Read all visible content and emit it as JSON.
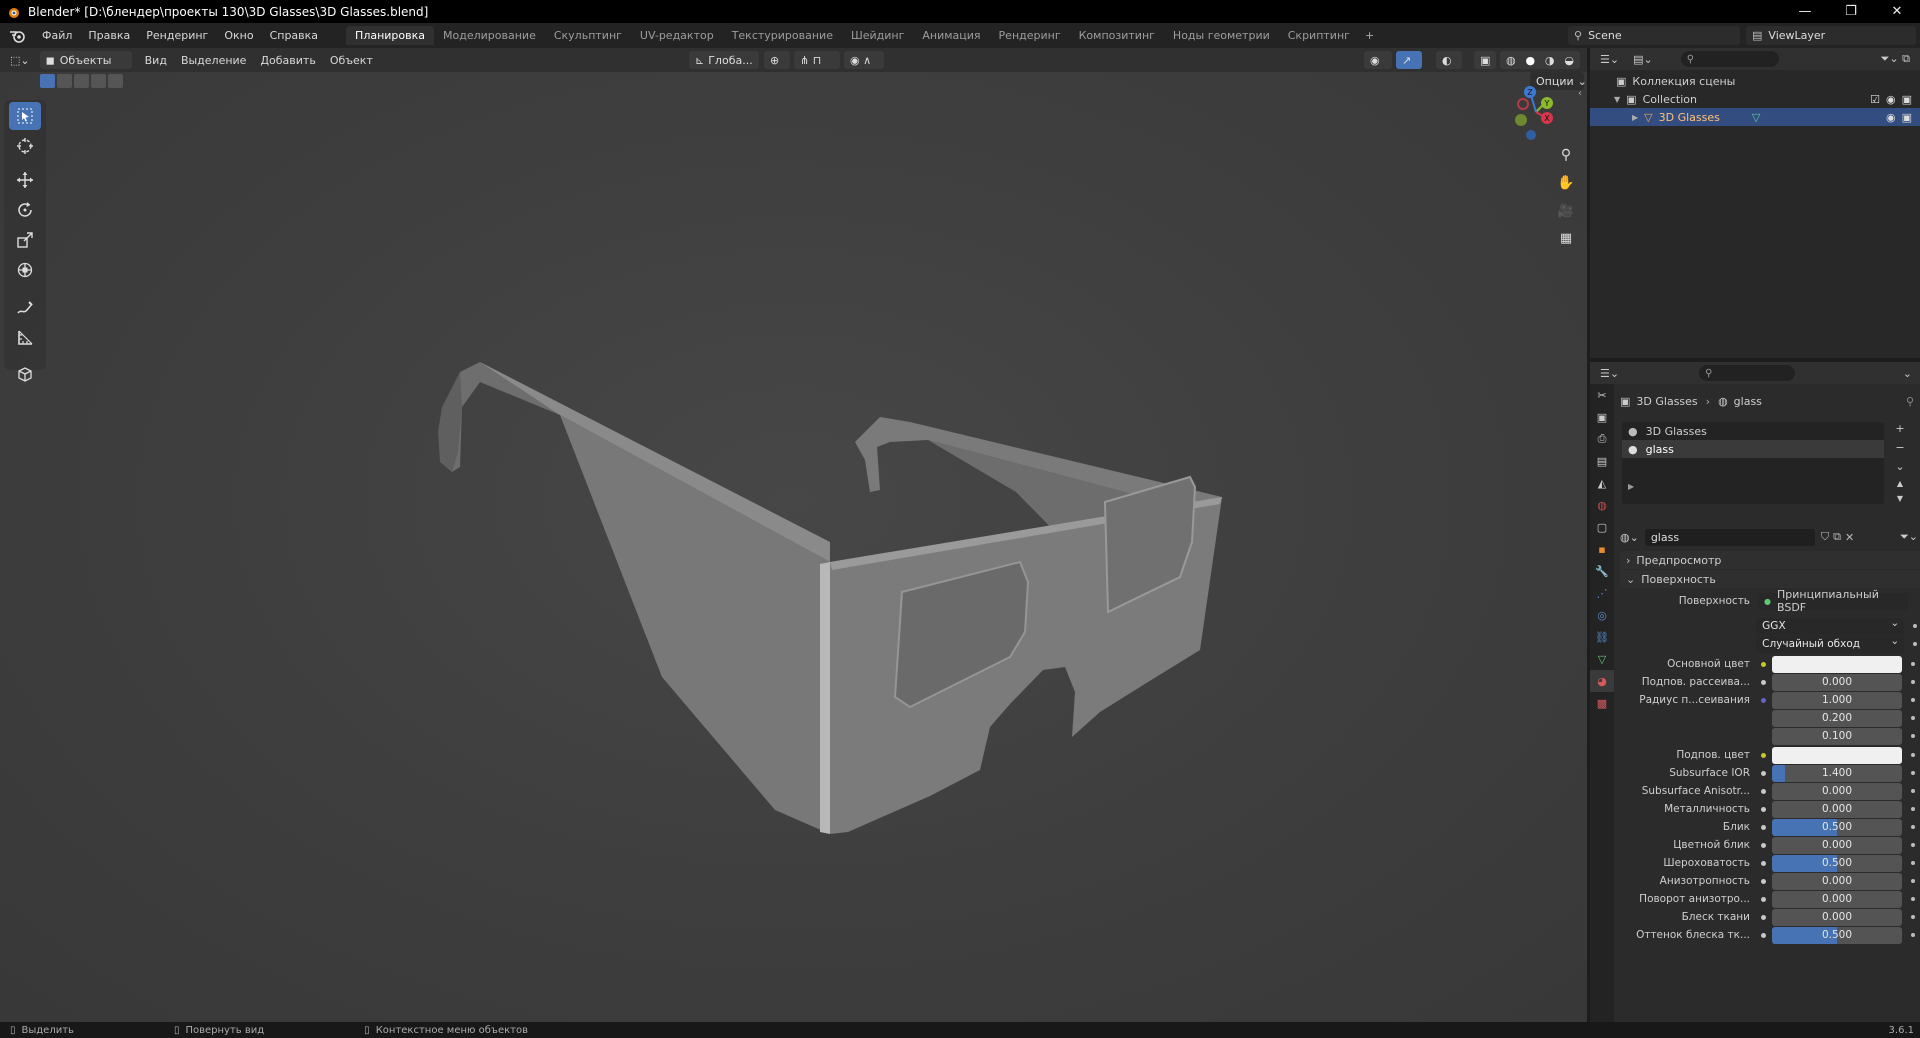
{
  "titlebar": {
    "title": "Blender* [D:\\блендер\\проекты 130\\3D Glasses\\3D Glasses.blend]",
    "minimize": "—",
    "maximize": "❐",
    "close": "✕"
  },
  "menubar": {
    "items": [
      "Файл",
      "Правка",
      "Рендеринг",
      "Окно",
      "Справка"
    ],
    "workspaces": [
      "Планировка",
      "Моделирование",
      "Скульптинг",
      "UV-редактор",
      "Текстурирование",
      "Шейдинг",
      "Анимация",
      "Рендеринг",
      "Композитинг",
      "Ноды геометрии",
      "Скриптинг"
    ],
    "active_workspace": "Планировка",
    "add_workspace": "+",
    "scene": "Scene",
    "view_layer": "ViewLayer"
  },
  "viewport_header": {
    "mode": "Объекты",
    "menus": [
      "Вид",
      "Выделение",
      "Добавить",
      "Объект"
    ],
    "transform_orientation": "Глоба...",
    "options": "Опции"
  },
  "outliner": {
    "scene_collection": "Коллекция сцены",
    "collection": "Collection",
    "object": "3D Glasses"
  },
  "properties": {
    "breadcrumb_object": "3D Glasses",
    "breadcrumb_material": "glass",
    "material_slots": [
      "3D Glasses",
      "glass"
    ],
    "material_name": "glass",
    "panel_preview": "Предпросмотр",
    "panel_surface": "Поверхность",
    "surface_label": "Поверхность",
    "surface_shader": "Принципиальный BSDF",
    "distribution": "GGX",
    "subsurface_method": "Случайный обход",
    "fields": [
      {
        "label": "Основной цвет",
        "type": "color",
        "value": "",
        "color": "#f0f0f0",
        "socket": "yellow"
      },
      {
        "label": "Подпов. рассеива...",
        "type": "number",
        "value": "0.000",
        "fill": 0,
        "socket": "gray"
      },
      {
        "label": "Радиус п...сеивания",
        "type": "number",
        "value": "1.000",
        "fill": 0,
        "socket": "blue"
      },
      {
        "label": "",
        "type": "number",
        "value": "0.200",
        "fill": 0,
        "socket": "none"
      },
      {
        "label": "",
        "type": "number",
        "value": "0.100",
        "fill": 0,
        "socket": "none"
      },
      {
        "label": "Подпов. цвет",
        "type": "color",
        "value": "",
        "color": "#f0f0f0",
        "socket": "yellow"
      },
      {
        "label": "Subsurface IOR",
        "type": "number",
        "value": "1.400",
        "fill": 0.1,
        "socket": "gray"
      },
      {
        "label": "Subsurface Anisotr...",
        "type": "number",
        "value": "0.000",
        "fill": 0,
        "socket": "gray"
      },
      {
        "label": "Металличность",
        "type": "number",
        "value": "0.000",
        "fill": 0,
        "socket": "gray"
      },
      {
        "label": "Блик",
        "type": "number",
        "value": "0.500",
        "fill": 0.5,
        "socket": "gray"
      },
      {
        "label": "Цветной блик",
        "type": "number",
        "value": "0.000",
        "fill": 0,
        "socket": "gray"
      },
      {
        "label": "Шероховатость",
        "type": "number",
        "value": "0.500",
        "fill": 0.5,
        "socket": "gray"
      },
      {
        "label": "Анизотропность",
        "type": "number",
        "value": "0.000",
        "fill": 0,
        "socket": "gray"
      },
      {
        "label": "Поворот анизотро...",
        "type": "number",
        "value": "0.000",
        "fill": 0,
        "socket": "gray"
      },
      {
        "label": "Блеск ткани",
        "type": "number",
        "value": "0.000",
        "fill": 0,
        "socket": "gray"
      },
      {
        "label": "Оттенок блеска тк...",
        "type": "number",
        "value": "0.500",
        "fill": 0.5,
        "socket": "gray"
      }
    ]
  },
  "statusbar": {
    "select": "Выделить",
    "rotate_view": "Повернуть вид",
    "context_menu": "Контекстное меню объектов",
    "version": "3.6.1"
  },
  "colors": {
    "accent": "#4772b3",
    "selection": "#334d80",
    "panel": "#2b2b2b",
    "viewport": "#3d3d3d"
  }
}
